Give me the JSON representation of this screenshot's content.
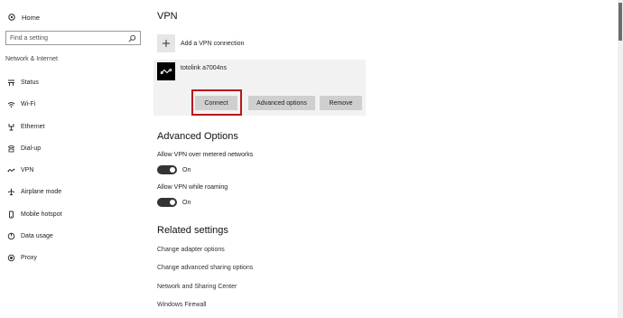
{
  "sidebar": {
    "home_label": "Home",
    "search_placeholder": "Find a setting",
    "section_title": "Network & Internet",
    "items": [
      {
        "label": "Status",
        "icon": "status-icon"
      },
      {
        "label": "Wi-Fi",
        "icon": "wifi-icon"
      },
      {
        "label": "Ethernet",
        "icon": "ethernet-icon"
      },
      {
        "label": "Dial-up",
        "icon": "dialup-icon"
      },
      {
        "label": "VPN",
        "icon": "vpn-icon"
      },
      {
        "label": "Airplane mode",
        "icon": "airplane-icon"
      },
      {
        "label": "Mobile hotspot",
        "icon": "hotspot-icon"
      },
      {
        "label": "Data usage",
        "icon": "data-usage-icon"
      },
      {
        "label": "Proxy",
        "icon": "proxy-icon"
      }
    ],
    "active_item": "VPN"
  },
  "main": {
    "title": "VPN",
    "add_label": "Add a VPN connection",
    "vpn_connection": {
      "name": "totolink a7004ns",
      "buttons": {
        "connect": "Connect",
        "advanced": "Advanced options",
        "remove": "Remove"
      }
    },
    "advanced_title": "Advanced Options",
    "options": [
      {
        "label": "Allow VPN over metered networks",
        "state": "On"
      },
      {
        "label": "Allow VPN while roaming",
        "state": "On"
      }
    ],
    "related_title": "Related settings",
    "related_links": [
      "Change adapter options",
      "Change advanced sharing options",
      "Network and Sharing Center",
      "Windows Firewall"
    ]
  },
  "colors": {
    "highlight_border": "#b8161b",
    "button_bg": "#cfcfcf",
    "card_bg": "#f2f2f2",
    "toggle_on": "#333333"
  }
}
